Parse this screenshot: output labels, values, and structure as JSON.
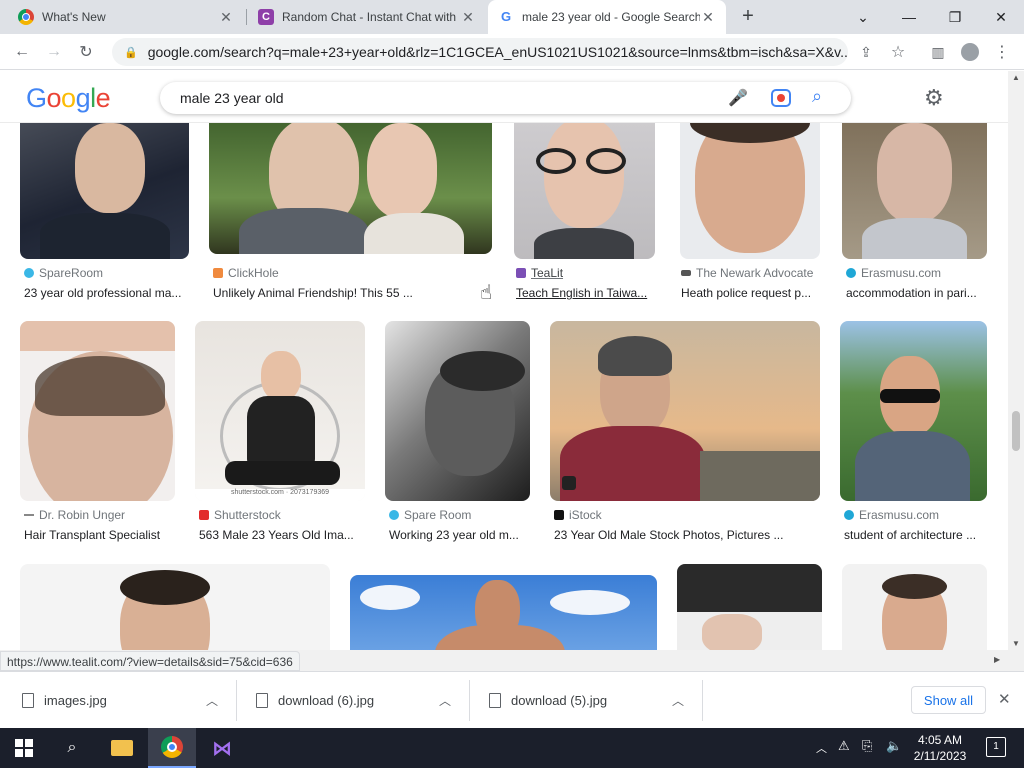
{
  "browser": {
    "tabs": [
      {
        "title": "What's New",
        "favicon": "chrome-icon"
      },
      {
        "title": "Random Chat - Instant Chat with",
        "favicon": "c-logo-icon"
      },
      {
        "title": "male 23 year old - Google Search",
        "favicon": "google-g-icon",
        "active": true
      }
    ],
    "new_tab_label": "+",
    "url": "google.com/search?q=male+23+year+old&rlz=1C1GCEA_enUS1021US1021&source=lnms&tbm=isch&sa=X&v..."
  },
  "google": {
    "logo": [
      "G",
      "o",
      "o",
      "g",
      "l",
      "e"
    ],
    "logo_colors": [
      "#4285f4",
      "#ea4335",
      "#fbbc05",
      "#4285f4",
      "#34a853",
      "#ea4335"
    ],
    "query": "male 23 year old"
  },
  "results": [
    {
      "source": "SpareRoom",
      "caption": "23 year old professional ma...",
      "source_color": "#3ab7e6"
    },
    {
      "source": "ClickHole",
      "caption": "Unlikely Animal Friendship! This 55 ...",
      "source_color": "#f08a3e"
    },
    {
      "source": "TeaLit",
      "caption": "Teach English in Taiwa...",
      "source_color": "#7b4fb5"
    },
    {
      "source": "The Newark Advocate",
      "caption": "Heath police request p...",
      "source_color": "#555555"
    },
    {
      "source": "Erasmusu.com",
      "caption": "accommodation in pari...",
      "source_color": "#1fa7d6"
    },
    {
      "source": "Dr. Robin Unger",
      "caption": "Hair Transplant Specialist",
      "source_color": "#888888"
    },
    {
      "source": "Shutterstock",
      "caption": "563 Male 23 Years Old Ima...",
      "source_color": "#e22c2c"
    },
    {
      "source": "Spare Room",
      "caption": "Working 23 year old m...",
      "source_color": "#3ab7e6"
    },
    {
      "source": "iStock",
      "caption": "23 Year Old Male Stock Photos, Pictures ...",
      "source_color": "#111111"
    },
    {
      "source": "Erasmusu.com",
      "caption": "student of architecture ...",
      "source_color": "#1fa7d6"
    }
  ],
  "status_url": "https://www.tealit.com/?view=details&sid=75&cid=636",
  "downloads": {
    "items": [
      "images.jpg",
      "download (6).jpg",
      "download (5).jpg"
    ],
    "show_all": "Show all"
  },
  "clock": {
    "time": "4:05 AM",
    "date": "2/11/2023"
  }
}
